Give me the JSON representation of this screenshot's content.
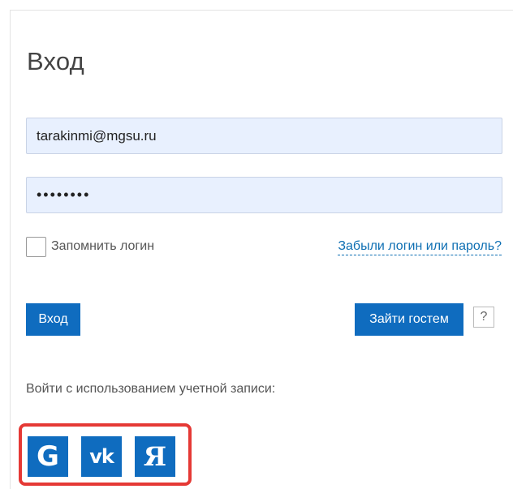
{
  "page": {
    "title": "Вход"
  },
  "form": {
    "login_value": "tarakinmi@mgsu.ru",
    "password_value": "••••••••",
    "remember_label": "Запомнить логин",
    "forgot_link": "Забыли логин или пароль?",
    "login_button": "Вход",
    "guest_button": "Зайти гостем",
    "help_label": "?"
  },
  "oauth": {
    "caption": "Войти с использованием учетной записи:",
    "providers": [
      {
        "name": "google",
        "label": "G",
        "icon": "google-icon"
      },
      {
        "name": "vkontakte",
        "label": "vk",
        "icon": "vk-icon"
      },
      {
        "name": "yandex",
        "label": "Я",
        "icon": "yandex-icon"
      }
    ],
    "highlight_color": "#e53935"
  },
  "colors": {
    "accent": "#0f6cbf",
    "input_bg": "#e8f0fe",
    "link": "#0e6fb3"
  }
}
